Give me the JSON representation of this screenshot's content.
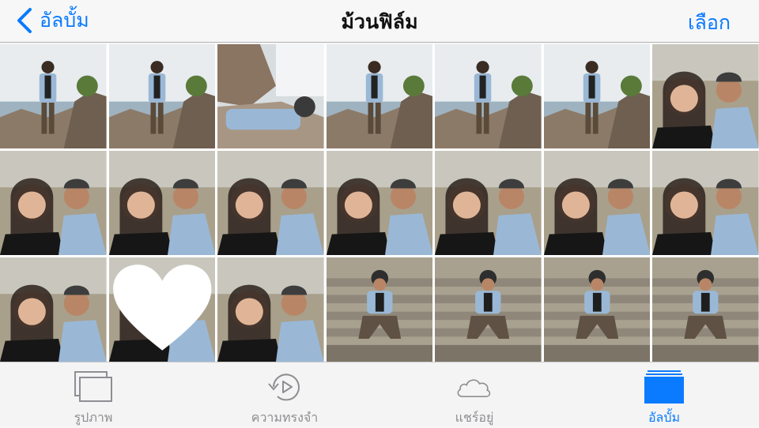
{
  "nav": {
    "back_label": "อัลบั้ม",
    "title": "ม้วนฟิล์ม",
    "select_label": "เลือก"
  },
  "tabs": [
    {
      "label": "รูปภาพ",
      "icon": "photos-icon",
      "active": false
    },
    {
      "label": "ความทรงจำ",
      "icon": "memories-icon",
      "active": false
    },
    {
      "label": "แชร์อยู่",
      "icon": "shared-cloud-icon",
      "active": false
    },
    {
      "label": "อัลบั้ม",
      "icon": "albums-icon",
      "active": true
    }
  ],
  "colors": {
    "accent": "#0a7aff",
    "inactive": "#8e8e93"
  },
  "photos": [
    {
      "scene": "beach-standing"
    },
    {
      "scene": "beach-standing"
    },
    {
      "scene": "rock-reclining"
    },
    {
      "scene": "beach-standing"
    },
    {
      "scene": "beach-standing"
    },
    {
      "scene": "beach-standing"
    },
    {
      "scene": "selfie"
    },
    {
      "scene": "selfie"
    },
    {
      "scene": "selfie"
    },
    {
      "scene": "selfie"
    },
    {
      "scene": "selfie"
    },
    {
      "scene": "selfie"
    },
    {
      "scene": "selfie"
    },
    {
      "scene": "selfie"
    },
    {
      "scene": "selfie"
    },
    {
      "scene": "selfie",
      "favorite": true
    },
    {
      "scene": "selfie"
    },
    {
      "scene": "stairs-sitting"
    },
    {
      "scene": "stairs-sitting"
    },
    {
      "scene": "stairs-sitting"
    },
    {
      "scene": "stairs-sitting"
    }
  ]
}
